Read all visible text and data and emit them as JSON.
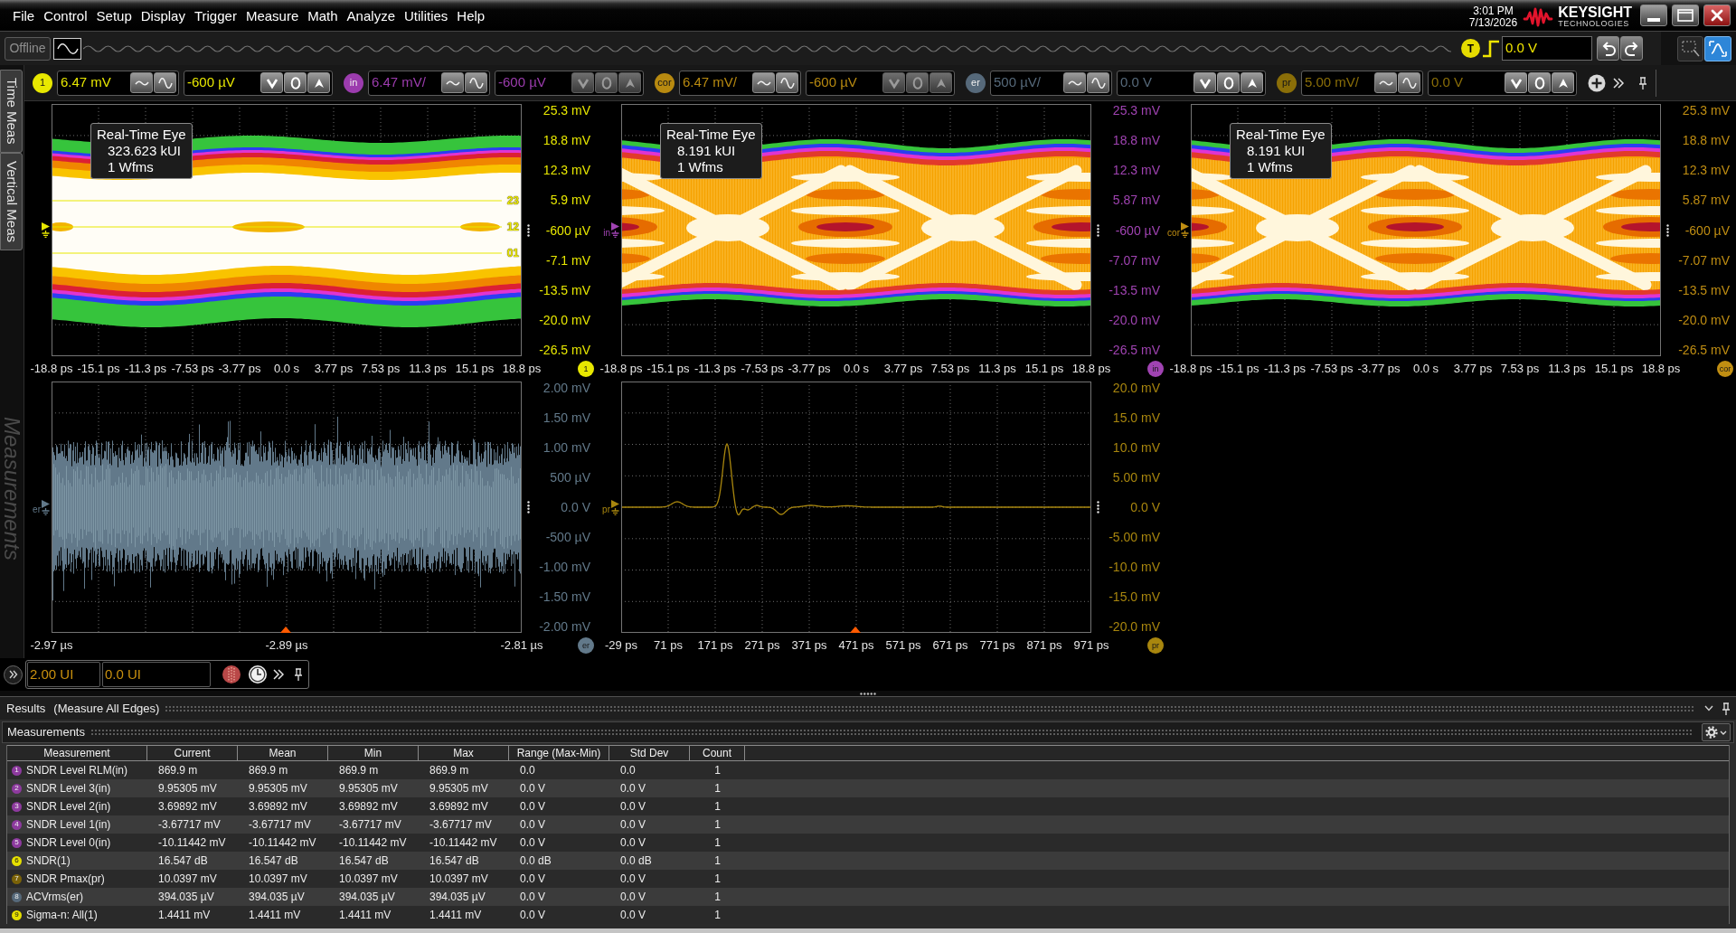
{
  "menu_bar": {
    "items": [
      "File",
      "Control",
      "Setup",
      "Display",
      "Trigger",
      "Measure",
      "Math",
      "Analyze",
      "Utilities",
      "Help"
    ],
    "clock": {
      "time": "3:01 PM",
      "date": "7/13/2026"
    },
    "logo": {
      "name": "KEYSIGHT",
      "tagline": "TECHNOLOGIES"
    }
  },
  "toolbar": {
    "status": "Offline",
    "trigger": {
      "badge": "T",
      "level": "0.0 V"
    }
  },
  "side_tabs": [
    {
      "label": "Time Meas",
      "disabled": false
    },
    {
      "label": "Vertical Meas",
      "disabled": false
    },
    {
      "label": "Measurements",
      "disabled": true
    }
  ],
  "channels": [
    {
      "badge": "1",
      "color": "#e8e800",
      "scale": "6.47 mV",
      "offset": "-600 µV",
      "offset_disabled": false
    },
    {
      "badge": "in",
      "color": "#9c3cae",
      "scale": "6.47 mV/",
      "offset": "-600 µV",
      "offset_disabled": true
    },
    {
      "badge": "cor",
      "color": "#b88a10",
      "scale": "6.47 mV/",
      "offset": "-600 µV",
      "offset_disabled": true
    },
    {
      "badge": "er",
      "color": "#56697a",
      "scale": "500 µV/",
      "offset": "0.0 V",
      "offset_disabled": false
    },
    {
      "badge": "pr",
      "color": "#8a6e08",
      "scale": "5.00 mV/",
      "offset": "0.0 V",
      "offset_disabled": false
    }
  ],
  "upper_panes": [
    {
      "kind": "open_eye",
      "badge": "1",
      "color": "#e8e800",
      "info": [
        "Real-Time Eye",
        "323.623 kUI",
        "1 Wfms"
      ],
      "thresholds": [
        "23",
        "12",
        "01"
      ],
      "y_labels": [
        "25.3 mV",
        "18.8 mV",
        "12.3 mV",
        "5.9 mV",
        "-600 µV",
        "-7.1 mV",
        "-13.5 mV",
        "-20.0 mV",
        "-26.5 mV"
      ],
      "x_labels": [
        "-18.8 ps",
        "-15.1 ps",
        "-11.3 ps",
        "-7.53 ps",
        "-3.77 ps",
        "0.0 s",
        "3.77 ps",
        "7.53 ps",
        "11.3 ps",
        "15.1 ps",
        "18.8 ps"
      ]
    },
    {
      "kind": "dense_eye",
      "badge": "in",
      "ground_label": "in",
      "color": "#a043b2",
      "info": [
        "Real-Time Eye",
        "8.191 kUI",
        "1 Wfms"
      ],
      "y_labels": [
        "25.3 mV",
        "18.8 mV",
        "12.3 mV",
        "5.87 mV",
        "-600 µV",
        "-7.07 mV",
        "-13.5 mV",
        "-20.0 mV",
        "-26.5 mV"
      ],
      "x_labels": [
        "-18.8 ps",
        "-15.1 ps",
        "-11.3 ps",
        "-7.53 ps",
        "-3.77 ps",
        "0.0 s",
        "3.77 ps",
        "7.53 ps",
        "11.3 ps",
        "15.1 ps",
        "18.8 ps"
      ]
    },
    {
      "kind": "dense_eye",
      "badge": "cor",
      "ground_label": "cor",
      "color": "#c08e12",
      "info": [
        "Real-Time Eye",
        "8.191 kUI",
        "1 Wfms"
      ],
      "y_labels": [
        "25.3 mV",
        "18.8 mV",
        "12.3 mV",
        "5.87 mV",
        "-600 µV",
        "-7.07 mV",
        "-13.5 mV",
        "-20.0 mV",
        "-26.5 mV"
      ],
      "x_labels": [
        "-18.8 ps",
        "-15.1 ps",
        "-11.3 ps",
        "-7.53 ps",
        "-3.77 ps",
        "0.0 s",
        "3.77 ps",
        "7.53 ps",
        "11.3 ps",
        "15.1 ps",
        "18.8 ps"
      ]
    }
  ],
  "lower_panes": [
    {
      "kind": "noise",
      "badge": "er",
      "ground_label": "er",
      "color": "#62798a",
      "time_marker": true,
      "y_labels": [
        "2.00 mV",
        "1.50 mV",
        "1.00 mV",
        "500 µV",
        "0.0 V",
        "-500 µV",
        "-1.00 mV",
        "-1.50 mV",
        "-2.00 mV"
      ],
      "x_labels": [
        "-2.97 µs",
        "-2.89 µs",
        "-2.81 µs"
      ]
    },
    {
      "kind": "pulse",
      "badge": "pr",
      "ground_label": "pr",
      "color": "#a8860e",
      "time_marker": true,
      "y_labels": [
        "20.0 mV",
        "15.0 mV",
        "10.0 mV",
        "5.00 mV",
        "0.0 V",
        "-5.00 mV",
        "-10.0 mV",
        "-15.0 mV",
        "-20.0 mV"
      ],
      "x_labels": [
        "-29 ps",
        "71 ps",
        "171 ps",
        "271 ps",
        "371 ps",
        "471 ps",
        "571 ps",
        "671 ps",
        "771 ps",
        "871 ps",
        "971 ps"
      ]
    }
  ],
  "eye_controls": {
    "fields": [
      "2.00 UI",
      "0.0 UI"
    ]
  },
  "results": {
    "title": "Results",
    "mode": "(Measure All Edges)"
  },
  "measurements": {
    "title": "Measurements",
    "columns": [
      "Measurement",
      "Current",
      "Mean",
      "Min",
      "Max",
      "Range (Max-Min)",
      "Std Dev",
      "Count"
    ],
    "rows": [
      {
        "index": "1",
        "color": "#8d3a9e",
        "cells": [
          "SNDR Level RLM(in)",
          "869.9 m",
          "869.9 m",
          "869.9 m",
          "869.9 m",
          "0.0",
          "0.0",
          "1"
        ]
      },
      {
        "index": "2",
        "color": "#8d3a9e",
        "cells": [
          "SNDR Level 3(in)",
          "9.95305 mV",
          "9.95305 mV",
          "9.95305 mV",
          "9.95305 mV",
          "0.0 V",
          "0.0 V",
          "1"
        ]
      },
      {
        "index": "3",
        "color": "#8d3a9e",
        "cells": [
          "SNDR Level 2(in)",
          "3.69892 mV",
          "3.69892 mV",
          "3.69892 mV",
          "3.69892 mV",
          "0.0 V",
          "0.0 V",
          "1"
        ]
      },
      {
        "index": "4",
        "color": "#8d3a9e",
        "cells": [
          "SNDR Level 1(in)",
          "-3.67717 mV",
          "-3.67717 mV",
          "-3.67717 mV",
          "-3.67717 mV",
          "0.0 V",
          "0.0 V",
          "1"
        ]
      },
      {
        "index": "5",
        "color": "#8d3a9e",
        "cells": [
          "SNDR Level 0(in)",
          "-10.11442 mV",
          "-10.11442 mV",
          "-10.11442 mV",
          "-10.11442 mV",
          "0.0 V",
          "0.0 V",
          "1"
        ]
      },
      {
        "index": "6",
        "color": "#e6e000",
        "cells": [
          "SNDR(1)",
          "16.547 dB",
          "16.547 dB",
          "16.547 dB",
          "16.547 dB",
          "0.0 dB",
          "0.0 dB",
          "1"
        ]
      },
      {
        "index": "7",
        "color": "#7a6208",
        "cells": [
          "SNDR Pmax(pr)",
          "10.0397 mV",
          "10.0397 mV",
          "10.0397 mV",
          "10.0397 mV",
          "0.0 V",
          "0.0 V",
          "1"
        ]
      },
      {
        "index": "8",
        "color": "#56697a",
        "cells": [
          "ACVrms(er)",
          "394.035 µV",
          "394.035 µV",
          "394.035 µV",
          "394.035 µV",
          "0.0 V",
          "0.0 V",
          "1"
        ]
      },
      {
        "index": "9",
        "color": "#e6e000",
        "cells": [
          "Sigma-n: All(1)",
          "1.4411 mV",
          "1.4411 mV",
          "1.4411 mV",
          "1.4411 mV",
          "0.0 V",
          "0.0 V",
          "1"
        ]
      }
    ]
  }
}
